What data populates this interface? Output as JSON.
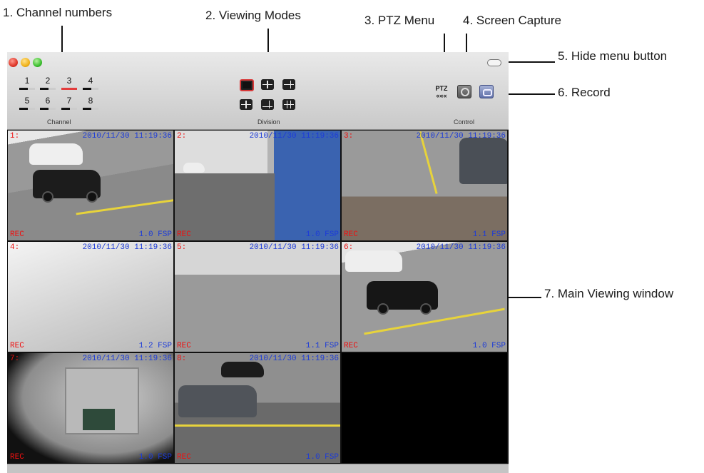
{
  "callouts": {
    "channel_numbers": "1. Channel numbers",
    "viewing_modes": "2. Viewing Modes",
    "ptz_menu": "3. PTZ Menu",
    "screen_capture": "4. Screen Capture",
    "hide_menu": "5. Hide menu button",
    "record": "6. Record",
    "main_window": "7. Main Viewing window"
  },
  "toolbar": {
    "channels": [
      "1",
      "2",
      "3",
      "4",
      "5",
      "6",
      "7",
      "8"
    ],
    "active_channel": "3",
    "channel_group_label": "Channel",
    "division_group_label": "Division",
    "control_group_label": "Control",
    "ptz_label": "PTZ",
    "ptz_arrows": "«««"
  },
  "cameras": [
    {
      "id": "1:",
      "timestamp": "2010/11/30 11:19:36",
      "rec": "REC",
      "fps": "1.0 FSP"
    },
    {
      "id": "2:",
      "timestamp": "2010/11/30 11:19:36",
      "rec": "REC",
      "fps": "1.0 FSP"
    },
    {
      "id": "3:",
      "timestamp": "2010/11/30 11:19:36",
      "rec": "REC",
      "fps": "1.1 FSP"
    },
    {
      "id": "4:",
      "timestamp": "2010/11/30 11:19:36",
      "rec": "REC",
      "fps": "1.2 FSP"
    },
    {
      "id": "5:",
      "timestamp": "2010/11/30 11:19:36",
      "rec": "REC",
      "fps": "1.1 FSP"
    },
    {
      "id": "6:",
      "timestamp": "2010/11/30 11:19:36",
      "rec": "REC",
      "fps": "1.0 FSP"
    },
    {
      "id": "7:",
      "timestamp": "2010/11/30 11:19:36",
      "rec": "REC",
      "fps": "1.0 FSP"
    },
    {
      "id": "8:",
      "timestamp": "2010/11/30 11:19:36",
      "rec": "REC",
      "fps": "1.0 FSP"
    }
  ],
  "colors": {
    "accent_red": "#e23c3c",
    "timestamp_blue": "#1c3bd8"
  },
  "icons": [
    "close-icon",
    "minimize-icon",
    "zoom-icon",
    "single-view-icon",
    "quad-view-icon",
    "ptz-icon",
    "camera-icon",
    "record-icon"
  ]
}
